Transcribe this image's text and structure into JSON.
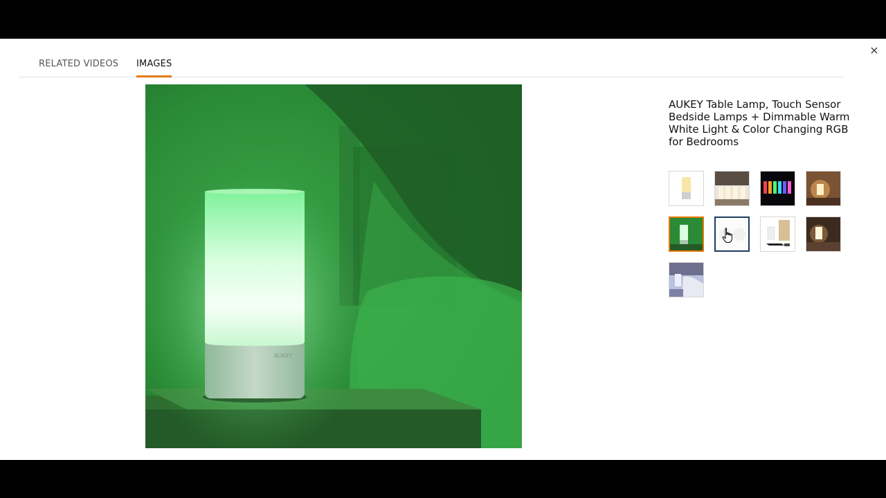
{
  "tabs": [
    {
      "label": "RELATED VIDEOS",
      "active": false
    },
    {
      "label": "IMAGES",
      "active": true
    }
  ],
  "close_label": "×",
  "product": {
    "title": "AUKEY Table Lamp, Touch Sensor Bedside Lamps + Dimmable Warm White Light & Color Changing RGB for Bedrooms",
    "brand_mark": "AUKEY"
  },
  "thumbnails": [
    {
      "name": "thumb-warm-white-lamp",
      "state": "default"
    },
    {
      "name": "thumb-lamp-lineup",
      "state": "default"
    },
    {
      "name": "thumb-rgb-colors",
      "state": "default"
    },
    {
      "name": "thumb-lamp-on-desk",
      "state": "default"
    },
    {
      "name": "thumb-green-lamp",
      "state": "selected"
    },
    {
      "name": "thumb-white-lamp",
      "state": "hovered"
    },
    {
      "name": "thumb-package-contents",
      "state": "default"
    },
    {
      "name": "thumb-lamp-bedroom",
      "state": "default"
    },
    {
      "name": "thumb-lamp-lifestyle",
      "state": "default"
    }
  ],
  "colors": {
    "tab_underline": "#e47911",
    "selected_border": "#e77600",
    "hover_border": "#1b3b5f"
  }
}
